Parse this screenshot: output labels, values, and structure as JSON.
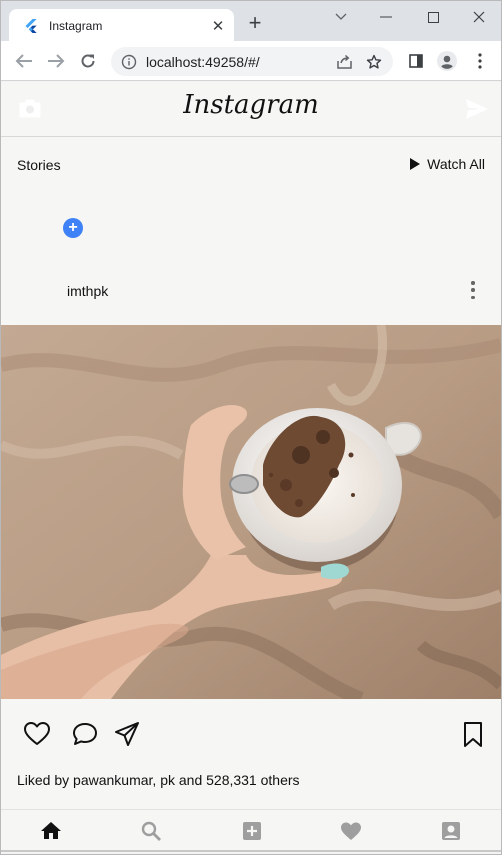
{
  "browser": {
    "tab_title": "Instagram",
    "url": "localhost:49258/#/"
  },
  "app": {
    "logo": "Instagram",
    "stories_label": "Stories",
    "watch_all_label": "Watch All",
    "story_add_symbol": "+",
    "post_username": "imthpk",
    "likes_text": "Liked by pawankumar, pk and 528,331 others"
  },
  "colors": {
    "accent": "#3f82f7",
    "app_background": "#f6f6f4"
  },
  "icons": {
    "camera": "camera-icon",
    "send": "send-icon",
    "heart": "heart-outline-icon",
    "comment": "comment-icon",
    "share": "paper-plane-icon",
    "bookmark": "bookmark-icon",
    "nav": [
      "home-icon",
      "search-icon",
      "add-box-icon",
      "heart-icon",
      "account-box-icon"
    ]
  }
}
